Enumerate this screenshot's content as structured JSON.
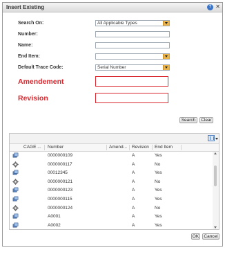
{
  "dialog": {
    "title": "Insert Existing"
  },
  "search": {
    "search_on_label": "Search On:",
    "search_on_value": "All Applicable Types",
    "number_label": "Number:",
    "number_value": "",
    "name_label": "Name:",
    "name_value": "",
    "end_item_label": "End Item:",
    "end_item_value": "",
    "trace_label": "Default Trace Code:",
    "trace_value": "Serial Number",
    "amendment_label": "Amendement",
    "amendment_value": "",
    "revision_label": "Revision",
    "revision_value": "",
    "search_button": "Search",
    "clear_button": "Clear"
  },
  "grid": {
    "columns": [
      "CAGE ...",
      "Number",
      "Amend...",
      "Revision",
      "End Item"
    ],
    "rows": [
      {
        "icon": "part-icon",
        "cage": "",
        "number": "0000000109",
        "amendment": "",
        "revision": "A",
        "end_item": "Yes"
      },
      {
        "icon": "gear-part-icon",
        "cage": "",
        "number": "0000000117",
        "amendment": "",
        "revision": "A",
        "end_item": "No"
      },
      {
        "icon": "part-icon",
        "cage": "",
        "number": "00012345",
        "amendment": "",
        "revision": "A",
        "end_item": "Yes"
      },
      {
        "icon": "gear-part-icon",
        "cage": "",
        "number": "0000000121",
        "amendment": "",
        "revision": "A",
        "end_item": "No"
      },
      {
        "icon": "part-icon",
        "cage": "",
        "number": "0000000123",
        "amendment": "",
        "revision": "A",
        "end_item": "Yes"
      },
      {
        "icon": "part-icon",
        "cage": "",
        "number": "0000000115",
        "amendment": "",
        "revision": "A",
        "end_item": "Yes"
      },
      {
        "icon": "gear-part-icon",
        "cage": "",
        "number": "0000000124",
        "amendment": "",
        "revision": "A",
        "end_item": "No"
      },
      {
        "icon": "part-icon",
        "cage": "",
        "number": "A0001",
        "amendment": "",
        "revision": "A",
        "end_item": "Yes"
      },
      {
        "icon": "part-icon",
        "cage": "",
        "number": "A0002",
        "amendment": "",
        "revision": "A",
        "end_item": "Yes"
      }
    ]
  },
  "footer": {
    "ok_button": "OK",
    "cancel_button": "Cancel"
  },
  "colors": {
    "accent_red": "#d8282e",
    "dropdown_orange": "#e9b44c",
    "help_blue": "#3a74c9"
  }
}
